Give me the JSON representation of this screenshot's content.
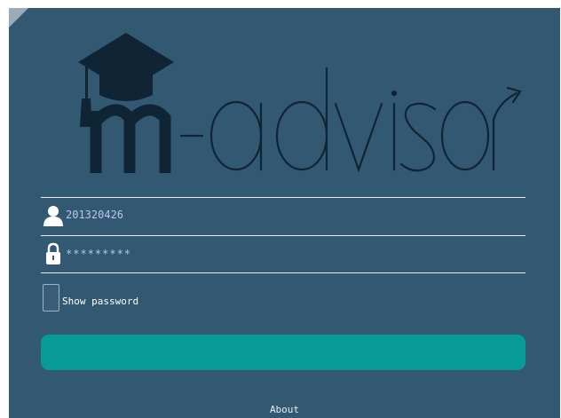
{
  "logo": {
    "text_m": "m",
    "text_rest": "-advisor",
    "color": "#0f2536"
  },
  "login": {
    "username_value": "201320426",
    "password_value": "*********",
    "show_password_label": "Show password",
    "submit_label": "",
    "about_label": "About"
  },
  "colors": {
    "background": "#335872",
    "button": "#079b97",
    "input_text": "#b9c6f2"
  }
}
